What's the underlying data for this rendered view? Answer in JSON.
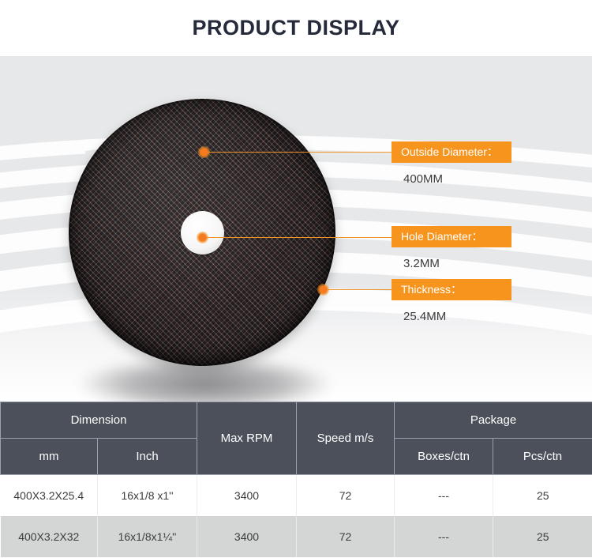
{
  "header": {
    "title": "PRODUCT DISPLAY"
  },
  "colors": {
    "accent_orange": "#f7941e",
    "marker_orange": "#f47b20",
    "title_navy": "#262b3c",
    "table_header_bg": "#4b505a",
    "hero_bg": "#e7e8ea",
    "row_alt_bg": "#d4d5d5",
    "disc_body": "#413639"
  },
  "hero": {
    "product_name": "cutting-disc",
    "callouts": [
      {
        "label": "Outside Diameter：",
        "value": "400MM",
        "marker": "callout-dot-outside-diameter"
      },
      {
        "label": "Hole Diameter：",
        "value": "3.2MM",
        "marker": "callout-dot-hole-diameter"
      },
      {
        "label": "Thickness：",
        "value": "25.4MM",
        "marker": "callout-dot-thickness"
      }
    ]
  },
  "spec_table": {
    "group_headers": {
      "dimension": "Dimension",
      "max_rpm": "Max  RPM",
      "speed": "Speed m/s",
      "package": "Package"
    },
    "sub_headers": {
      "mm": "mm",
      "inch": "Inch",
      "boxes_per_ctn": "Boxes/ctn",
      "pcs_per_ctn": "Pcs/ctn"
    },
    "rows": [
      {
        "mm": "400X3.2X25.4",
        "inch": "16x1/8 x1''",
        "max_rpm": "3400",
        "speed": "72",
        "boxes_per_ctn": "---",
        "pcs_per_ctn": "25"
      },
      {
        "mm": "400X3.2X32",
        "inch": "16x1/8x1¼''",
        "max_rpm": "3400",
        "speed": "72",
        "boxes_per_ctn": "---",
        "pcs_per_ctn": "25"
      }
    ]
  }
}
